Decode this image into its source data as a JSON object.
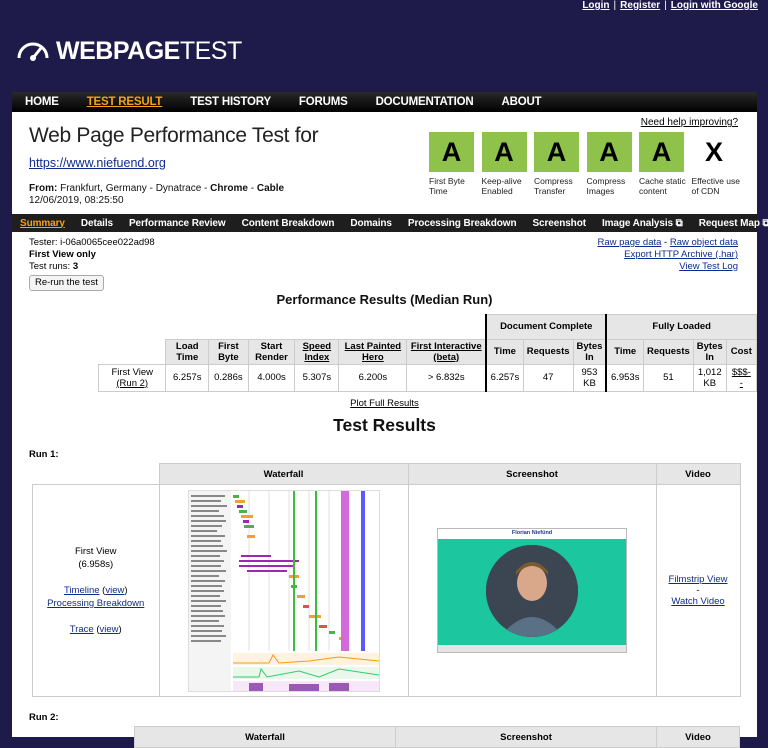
{
  "top_links": [
    "Login",
    "Register",
    "Login with Google"
  ],
  "logo": {
    "bold": "WEBPAGE",
    "rest": "TEST"
  },
  "nav": [
    "HOME",
    "TEST RESULT",
    "TEST HISTORY",
    "FORUMS",
    "DOCUMENTATION",
    "ABOUT"
  ],
  "header": {
    "title": "Web Page Performance Test for",
    "url": "https://www.niefuend.org",
    "from_label": "From:",
    "from_location": " Frankfurt, Germany - Dynatrace - ",
    "browser": "Chrome",
    "connection": "Cable",
    "date": "12/06/2019, 08:25:50",
    "help": "Need help improving?"
  },
  "grades": [
    {
      "grade": "A",
      "label": "First Byte Time",
      "color": "#8ec24a"
    },
    {
      "grade": "A",
      "label": "Keep-alive Enabled",
      "color": "#8ec24a"
    },
    {
      "grade": "A",
      "label": "Compress Transfer",
      "color": "#8ec24a"
    },
    {
      "grade": "A",
      "label": "Compress Images",
      "color": "#8ec24a"
    },
    {
      "grade": "A",
      "label": "Cache static content",
      "color": "#8ec24a"
    },
    {
      "grade": "X",
      "label": "Effective use of CDN"
    }
  ],
  "subnav": [
    "Summary",
    "Details",
    "Performance Review",
    "Content Breakdown",
    "Domains",
    "Processing Breakdown",
    "Screenshot",
    "Image Analysis",
    "Request Map"
  ],
  "meta": {
    "tester": "Tester: i-06a0065cee022ad98",
    "view": "First View only",
    "runs_label": "Test runs: ",
    "runs": "3",
    "rerun": "Re-run the test"
  },
  "result_links": {
    "raw_page": "Raw page data",
    "dash": " - ",
    "raw_object": "Raw object data",
    "har": "Export HTTP Archive (.har)",
    "log": "View Test Log"
  },
  "perf": {
    "heading": "Performance Results (Median Run)",
    "doc_complete": "Document Complete",
    "fully_loaded": "Fully Loaded",
    "columns": [
      "Load Time",
      "First Byte",
      "Start Render",
      "Speed Index",
      "Last Painted Hero",
      "First Interactive (beta)",
      "Time",
      "Requests",
      "Bytes In",
      "Time",
      "Requests",
      "Bytes In",
      "Cost"
    ],
    "row_label": "First View",
    "row_run": "(Run 2)",
    "values": [
      "6.257s",
      "0.286s",
      "4.000s",
      "5.307s",
      "6.200s",
      "> 6.832s",
      "6.257s",
      "47",
      "953 KB",
      "6.953s",
      "51",
      "1,012 KB",
      "$$$-"
    ],
    "cost_extra": "-",
    "plot_full": "Plot Full Results"
  },
  "test_results_heading": "Test Results",
  "run1": {
    "label": "Run 1:",
    "columns": [
      "Waterfall",
      "Screenshot",
      "Video"
    ],
    "fv_label": "First View",
    "fv_time": "(6.958s)",
    "timeline": "Timeline",
    "view": "view",
    "processing": "Processing Breakdown",
    "trace": "Trace",
    "screenshot_name": "Florian Niefünd",
    "filmstrip": "Filmstrip View",
    "dash": "-",
    "watch": "Watch Video"
  },
  "run2": {
    "label": "Run 2:",
    "columns": [
      "Waterfall",
      "Screenshot",
      "Video"
    ]
  }
}
